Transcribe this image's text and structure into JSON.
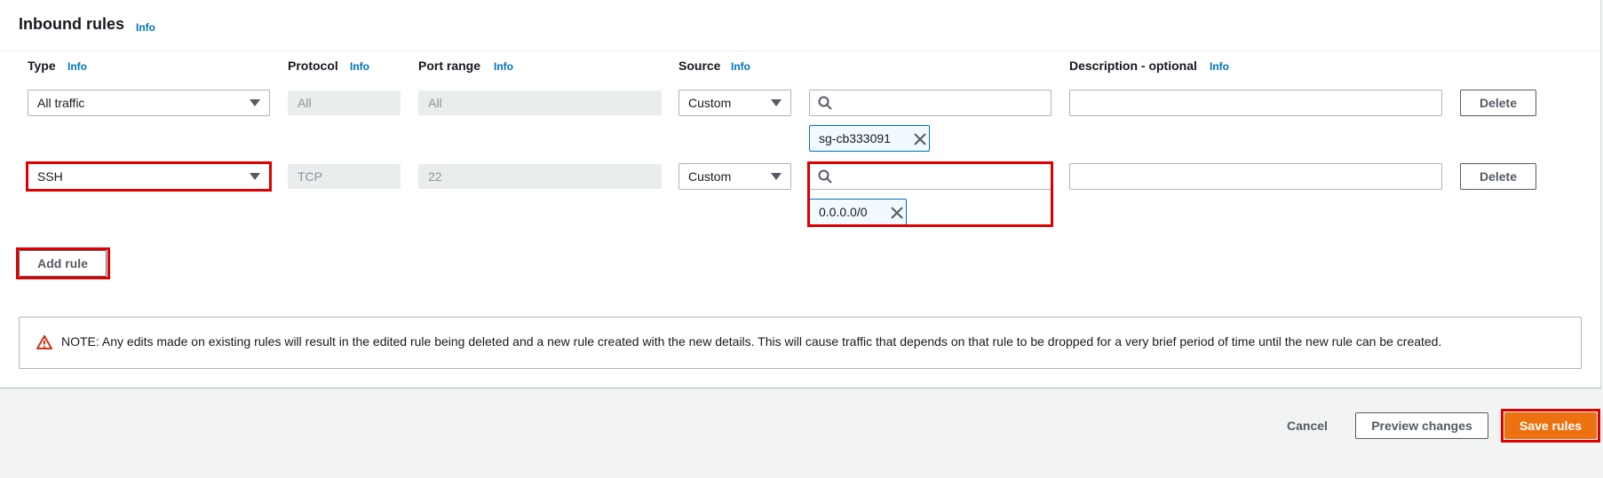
{
  "section": {
    "title": "Inbound rules",
    "info_label": "Info"
  },
  "columns": {
    "type": "Type",
    "protocol": "Protocol",
    "port_range": "Port range",
    "source": "Source",
    "description": "Description - optional",
    "info_label": "Info"
  },
  "rules": [
    {
      "type": "All traffic",
      "protocol": "All",
      "port_range": "All",
      "source_type": "Custom",
      "source_search": "",
      "source_token": "sg-cb333091",
      "description": "",
      "delete_label": "Delete"
    },
    {
      "type": "SSH",
      "protocol": "TCP",
      "port_range": "22",
      "source_type": "Custom",
      "source_search": "",
      "source_token": "0.0.0.0/0",
      "description": "",
      "delete_label": "Delete"
    }
  ],
  "add_rule_label": "Add rule",
  "note": {
    "text": "NOTE: Any edits made on existing rules will result in the edited rule being deleted and a new rule created with the new details. This will cause traffic that depends on that rule to be dropped for a very brief period of time until the new rule can be created.",
    "icon": "warning-icon"
  },
  "footer": {
    "cancel_label": "Cancel",
    "preview_label": "Preview changes",
    "save_label": "Save rules"
  },
  "colors": {
    "accent_link": "#0073bb",
    "primary_button": "#ec7211",
    "highlight_box": "#e00000",
    "warning": "#d13212"
  }
}
